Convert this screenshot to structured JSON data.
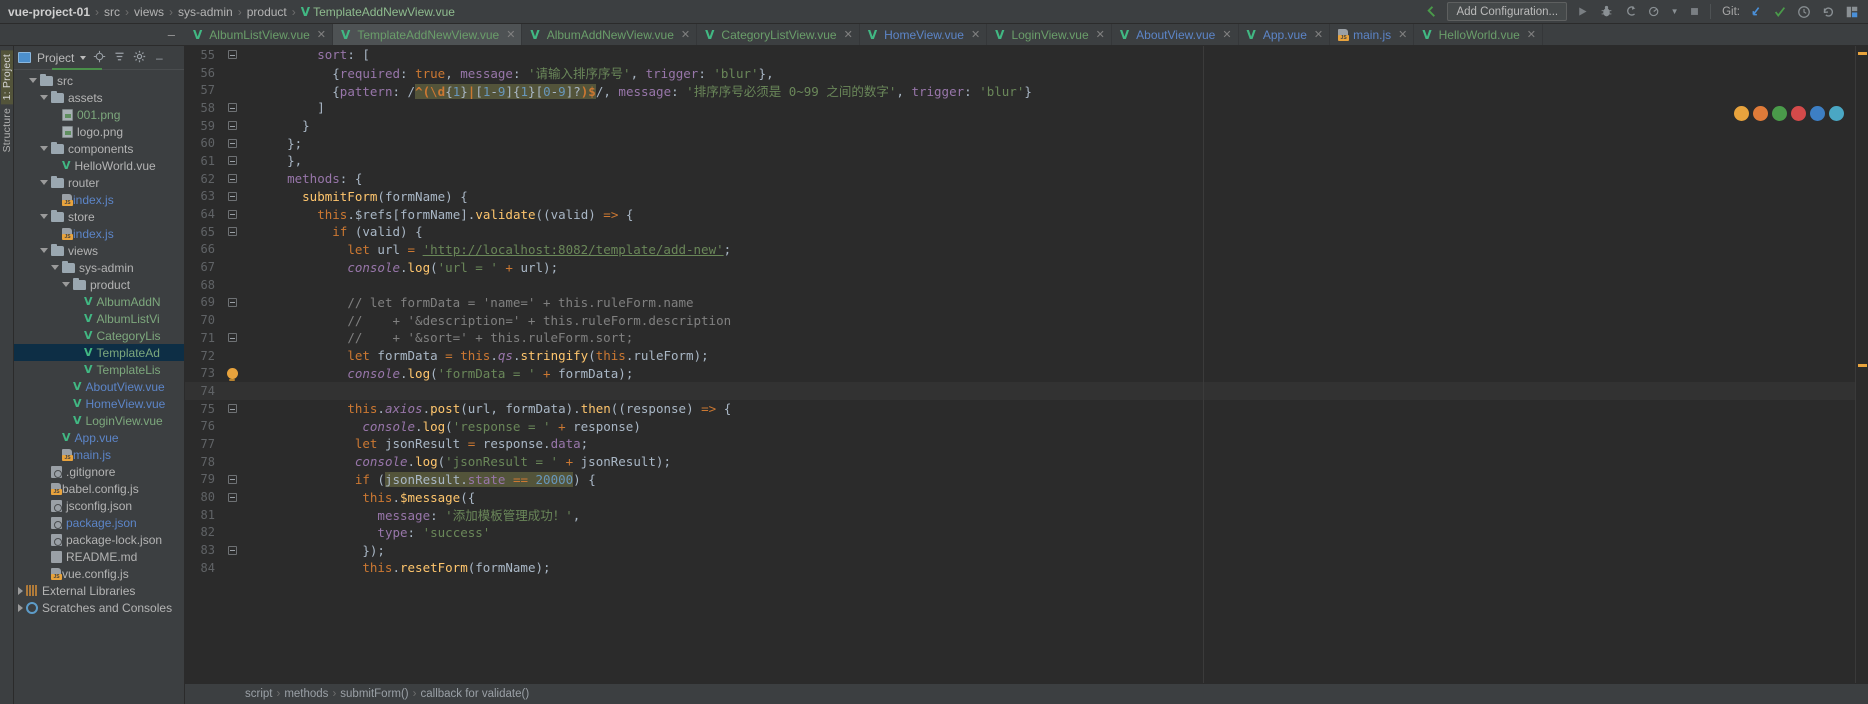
{
  "window": {
    "breadcrumb": {
      "root": "vue-project-01",
      "items": [
        "src",
        "views",
        "sys-admin",
        "product"
      ],
      "file": "TemplateAddNewView.vue",
      "separator": "›"
    },
    "toolbar": {
      "back_icon": "back-arrow-icon",
      "add_configuration": "Add Configuration...",
      "run_icon": "run-icon",
      "debug_icon": "debug-icon",
      "coverage_icon": "run-with-coverage-icon",
      "profile_icon": "profile-icon",
      "profile_dropdown_icon": "chevron-down-icon",
      "stop_icon": "stop-icon",
      "git_label": "Git:",
      "git_update_icon": "update-project-icon",
      "git_commit_icon": "commit-icon",
      "git_history_icon": "history-icon",
      "git_rollback_icon": "rollback-icon",
      "search_everywhere_icon": "layout-icon"
    }
  },
  "tabs": [
    {
      "label": "AlbumListView.vue",
      "icon": "vue-file-icon",
      "color": "green",
      "active": false,
      "closable": true
    },
    {
      "label": "TemplateAddNewView.vue",
      "icon": "vue-file-icon",
      "color": "green",
      "active": true,
      "closable": true
    },
    {
      "label": "AlbumAddNewView.vue",
      "icon": "vue-file-icon",
      "color": "green",
      "active": false,
      "closable": true
    },
    {
      "label": "CategoryListView.vue",
      "icon": "vue-file-icon",
      "color": "green",
      "active": false,
      "closable": true
    },
    {
      "label": "HomeView.vue",
      "icon": "vue-file-icon",
      "color": "blue",
      "active": false,
      "closable": true
    },
    {
      "label": "LoginView.vue",
      "icon": "vue-file-icon",
      "color": "green",
      "active": false,
      "closable": true
    },
    {
      "label": "AboutView.vue",
      "icon": "vue-file-icon",
      "color": "blue",
      "active": false,
      "closable": true
    },
    {
      "label": "App.vue",
      "icon": "vue-file-icon",
      "color": "blue",
      "active": false,
      "closable": true
    },
    {
      "label": "main.js",
      "icon": "js-file-icon",
      "color": "blue",
      "active": false,
      "closable": true
    },
    {
      "label": "HelloWorld.vue",
      "icon": "vue-file-icon",
      "color": "green",
      "active": false,
      "closable": true
    }
  ],
  "left_strip": {
    "tabs": [
      "1: Project",
      "Structure"
    ]
  },
  "project_panel": {
    "title": "Project",
    "dropdown_icon": "chevron-down-icon",
    "locate_icon": "locate-icon",
    "collapse_icon": "collapse-all-icon",
    "settings_icon": "gear-icon",
    "hide_icon": "hide-icon",
    "tree": [
      {
        "depth": 1,
        "label": "src",
        "type": "folder",
        "expanded": true,
        "color": "default"
      },
      {
        "depth": 2,
        "label": "assets",
        "type": "folder",
        "expanded": true,
        "color": "default"
      },
      {
        "depth": 3,
        "label": "001.png",
        "type": "image",
        "color": "green"
      },
      {
        "depth": 3,
        "label": "logo.png",
        "type": "image",
        "color": "default"
      },
      {
        "depth": 2,
        "label": "components",
        "type": "folder",
        "expanded": true,
        "color": "default"
      },
      {
        "depth": 3,
        "label": "HelloWorld.vue",
        "type": "vue",
        "color": "default"
      },
      {
        "depth": 2,
        "label": "router",
        "type": "folder",
        "expanded": true,
        "color": "default"
      },
      {
        "depth": 3,
        "label": "index.js",
        "type": "js",
        "color": "blue"
      },
      {
        "depth": 2,
        "label": "store",
        "type": "folder",
        "expanded": true,
        "color": "default"
      },
      {
        "depth": 3,
        "label": "index.js",
        "type": "js",
        "color": "blue"
      },
      {
        "depth": 2,
        "label": "views",
        "type": "folder",
        "expanded": true,
        "color": "default"
      },
      {
        "depth": 3,
        "label": "sys-admin",
        "type": "folder",
        "expanded": true,
        "color": "default"
      },
      {
        "depth": 4,
        "label": "product",
        "type": "folder",
        "expanded": true,
        "color": "default"
      },
      {
        "depth": 5,
        "label": "AlbumAddN",
        "type": "vue",
        "color": "green"
      },
      {
        "depth": 5,
        "label": "AlbumListVi",
        "type": "vue",
        "color": "green"
      },
      {
        "depth": 5,
        "label": "CategoryLis",
        "type": "vue",
        "color": "green"
      },
      {
        "depth": 5,
        "label": "TemplateAd",
        "type": "vue",
        "color": "green",
        "selected": true
      },
      {
        "depth": 5,
        "label": "TemplateLis",
        "type": "vue",
        "color": "green"
      },
      {
        "depth": 4,
        "label": "AboutView.vue",
        "type": "vue",
        "color": "blue"
      },
      {
        "depth": 4,
        "label": "HomeView.vue",
        "type": "vue",
        "color": "blue"
      },
      {
        "depth": 4,
        "label": "LoginView.vue",
        "type": "vue",
        "color": "green"
      },
      {
        "depth": 3,
        "label": "App.vue",
        "type": "vue",
        "color": "blue"
      },
      {
        "depth": 3,
        "label": "main.js",
        "type": "js",
        "color": "blue"
      },
      {
        "depth": 2,
        "label": ".gitignore",
        "type": "config",
        "color": "default"
      },
      {
        "depth": 2,
        "label": "babel.config.js",
        "type": "js",
        "color": "default"
      },
      {
        "depth": 2,
        "label": "jsconfig.json",
        "type": "config",
        "color": "default"
      },
      {
        "depth": 2,
        "label": "package.json",
        "type": "config",
        "color": "blue"
      },
      {
        "depth": 2,
        "label": "package-lock.json",
        "type": "config",
        "color": "default"
      },
      {
        "depth": 2,
        "label": "README.md",
        "type": "md",
        "color": "default"
      },
      {
        "depth": 2,
        "label": "vue.config.js",
        "type": "js",
        "color": "default"
      },
      {
        "depth": 0,
        "label": "External Libraries",
        "type": "library",
        "expanded": false,
        "color": "default"
      },
      {
        "depth": 0,
        "label": "Scratches and Consoles",
        "type": "scratches",
        "expanded": false,
        "color": "default"
      }
    ]
  },
  "editor": {
    "first_line": 55,
    "caret_line": 74,
    "bulb_line": 73,
    "lines": [
      {
        "n": 55,
        "fold": "minus",
        "indent": 8,
        "text": "sort: ["
      },
      {
        "n": 56,
        "fold": "none",
        "indent": 10,
        "text": "{required: true, message: '请输入排序序号', trigger: 'blur'},"
      },
      {
        "n": 57,
        "fold": "none",
        "indent": 10,
        "text": "{pattern: /^(\\d{1}|[1-9]{1}[0-9]?)$/, message: '排序序号必须是 0~99 之间的数字', trigger: 'blur'}"
      },
      {
        "n": 58,
        "fold": "minus",
        "indent": 8,
        "text": "]"
      },
      {
        "n": 59,
        "fold": "minus",
        "indent": 6,
        "text": "}"
      },
      {
        "n": 60,
        "fold": "minus",
        "indent": 4,
        "text": "};"
      },
      {
        "n": 61,
        "fold": "minus",
        "indent": 4,
        "text": "},"
      },
      {
        "n": 62,
        "fold": "minus",
        "indent": 4,
        "text": "methods: {"
      },
      {
        "n": 63,
        "fold": "minus",
        "indent": 6,
        "text": "submitForm(formName) {"
      },
      {
        "n": 64,
        "fold": "minus",
        "indent": 8,
        "text": "this.$refs[formName].validate((valid) => {"
      },
      {
        "n": 65,
        "fold": "minus",
        "indent": 10,
        "text": "if (valid) {"
      },
      {
        "n": 66,
        "fold": "none",
        "indent": 12,
        "text": "let url = 'http://localhost:8082/template/add-new';"
      },
      {
        "n": 67,
        "fold": "none",
        "indent": 12,
        "text": "console.log('url = ' + url);"
      },
      {
        "n": 68,
        "fold": "none",
        "indent": 0,
        "text": ""
      },
      {
        "n": 69,
        "fold": "minus",
        "indent": 12,
        "text": "// let formData = 'name=' + this.ruleForm.name"
      },
      {
        "n": 70,
        "fold": "none",
        "indent": 12,
        "text": "//    + '&description=' + this.ruleForm.description"
      },
      {
        "n": 71,
        "fold": "minus",
        "indent": 12,
        "text": "//    + '&sort=' + this.ruleForm.sort;"
      },
      {
        "n": 72,
        "fold": "none",
        "indent": 12,
        "text": "let formData = this.qs.stringify(this.ruleForm);"
      },
      {
        "n": 73,
        "fold": "bulb",
        "indent": 12,
        "text": "console.log('formData = ' + formData);"
      },
      {
        "n": 74,
        "fold": "none",
        "indent": 0,
        "text": ""
      },
      {
        "n": 75,
        "fold": "minus",
        "indent": 12,
        "text": "this.axios.post(url, formData).then((response) => {"
      },
      {
        "n": 76,
        "fold": "none",
        "indent": 14,
        "text": "console.log('response = ' + response)"
      },
      {
        "n": 77,
        "fold": "none",
        "indent": 13,
        "text": "let jsonResult = response.data;"
      },
      {
        "n": 78,
        "fold": "none",
        "indent": 13,
        "text": "console.log('jsonResult = ' + jsonResult);"
      },
      {
        "n": 79,
        "fold": "minus",
        "indent": 13,
        "text": "if (jsonResult.state == 20000) {"
      },
      {
        "n": 80,
        "fold": "minus",
        "indent": 14,
        "text": "this.$message({"
      },
      {
        "n": 81,
        "fold": "none",
        "indent": 16,
        "text": "message: '添加模板管理成功！',"
      },
      {
        "n": 82,
        "fold": "none",
        "indent": 16,
        "text": "type: 'success'"
      },
      {
        "n": 83,
        "fold": "minus",
        "indent": 14,
        "text": "});"
      },
      {
        "n": 84,
        "fold": "none",
        "indent": 14,
        "text": "this.resetForm(formName);"
      }
    ],
    "browser_icons": [
      {
        "name": "chrome-icon",
        "color": "#e8a33d"
      },
      {
        "name": "firefox-icon",
        "color": "#e07b39"
      },
      {
        "name": "safari-icon",
        "color": "#4a9b4a"
      },
      {
        "name": "opera-icon",
        "color": "#d44a4a"
      },
      {
        "name": "edge-icon",
        "color": "#3d7fc4"
      },
      {
        "name": "explorer-icon",
        "color": "#4aa7c4"
      }
    ]
  },
  "bottom_breadcrumb": {
    "items": [
      "script",
      "methods",
      "submitForm()",
      "callback for validate()"
    ],
    "separator": "›"
  }
}
